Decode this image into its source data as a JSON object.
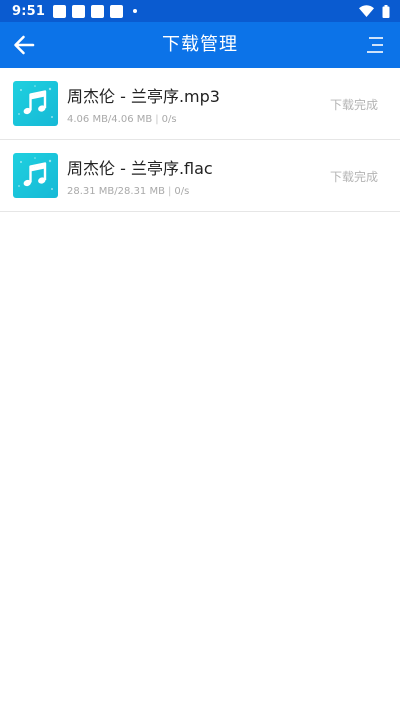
{
  "status_bar": {
    "time": "9:51",
    "notification_icons": [
      "app-notification-icon",
      "app-notification-icon",
      "app-notification-icon",
      "app-notification-icon"
    ],
    "system_icons": [
      "wifi-icon",
      "battery-icon"
    ],
    "background": "#0a5bd0"
  },
  "app_bar": {
    "title": "下载管理",
    "back_icon": "arrow-left-icon",
    "menu_icon": "menu-icon",
    "background": "#0c73e8"
  },
  "downloads": [
    {
      "name": "周杰伦 - 兰亭序.mp3",
      "size_done": "4.06 MB/4.06 MB",
      "speed": "0/s",
      "status": "下载完成",
      "icon": "music-note-icon"
    },
    {
      "name": "周杰伦 - 兰亭序.flac",
      "size_done": "28.31 MB/28.31 MB",
      "speed": "0/s",
      "status": "下载完成",
      "icon": "music-note-icon"
    }
  ],
  "colors": {
    "accent": "#0c73e8",
    "thumb": "#1fd0df",
    "status_text": "#b4b4b4"
  }
}
